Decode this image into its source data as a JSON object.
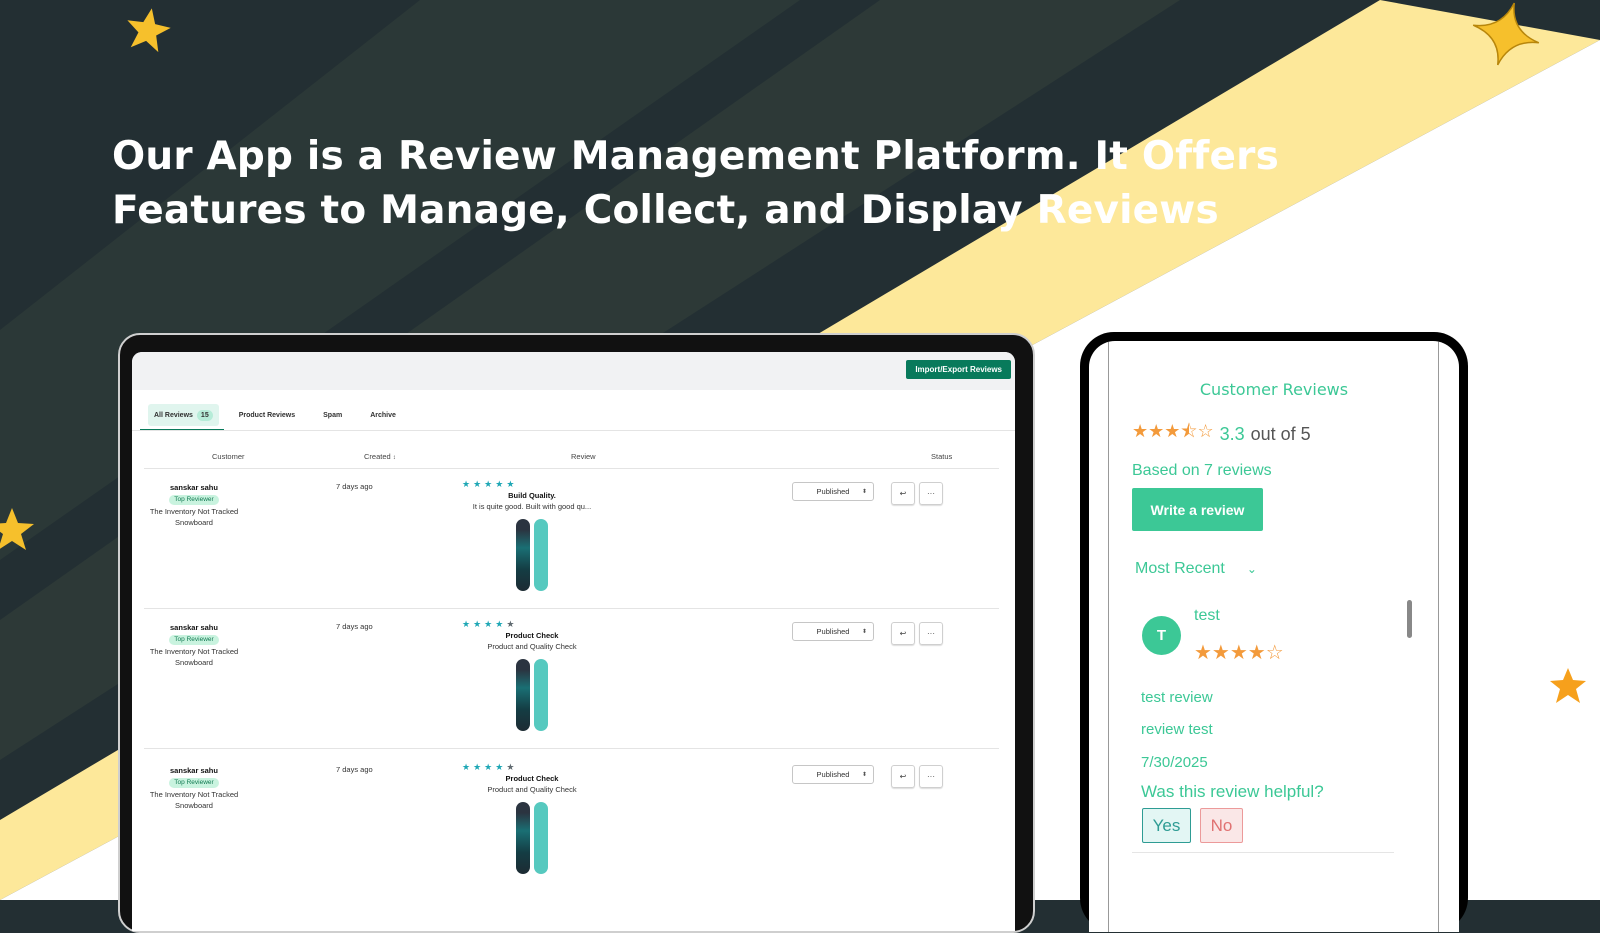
{
  "headline": "Our App is a Review Management Platform. It Offers Features to Manage, Collect, and Display Reviews",
  "colors": {
    "background": "#232f33",
    "stripe": "#fde89a",
    "accent_green": "#087a5b",
    "widget_green": "#3cc896",
    "star_orange": "#f39a3b",
    "star_teal": "#1ea7b5"
  },
  "admin": {
    "import_export_label": "Import/Export Reviews",
    "tabs": [
      {
        "label": "All Reviews",
        "count": "15"
      },
      {
        "label": "Product Reviews"
      },
      {
        "label": "Spam"
      },
      {
        "label": "Archive"
      }
    ],
    "columns": {
      "customer": "Customer",
      "created": "Created",
      "created_sort_icon": "↕",
      "review": "Review",
      "status": "Status"
    },
    "rows": [
      {
        "customer": "sanskar sahu",
        "badge": "Top Reviewer",
        "product": "The Inventory Not Tracked Snowboard",
        "created": "7 days ago",
        "rating": 5,
        "title": "Build Quality.",
        "body": "It is quite good. Built with good qu...",
        "status": "Published"
      },
      {
        "customer": "sanskar sahu",
        "badge": "Top Reviewer",
        "product": "The Inventory Not Tracked Snowboard",
        "created": "7 days ago",
        "rating": 4,
        "title": "Product Check",
        "body": "Product and Quality Check",
        "status": "Published"
      },
      {
        "customer": "sanskar sahu",
        "badge": "Top Reviewer",
        "product": "The Inventory Not Tracked Snowboard",
        "created": "7 days ago",
        "rating": 4,
        "title": "Product Check",
        "body": "Product and Quality Check",
        "status": "Published"
      }
    ]
  },
  "widget": {
    "title": "Customer Reviews",
    "average": "3.3",
    "out_of": "out of 5",
    "average_stars": "★★★⯪☆",
    "based_on": "Based on 7 reviews",
    "write_label": "Write a review",
    "sort_label": "Most Recent",
    "review": {
      "avatar_letter": "T",
      "name": "test",
      "stars": "★★★★☆",
      "title": "test review",
      "body": "review test",
      "date": "7/30/2025",
      "helpful_question": "Was this review helpful?",
      "yes_label": "Yes",
      "no_label": "No"
    }
  }
}
